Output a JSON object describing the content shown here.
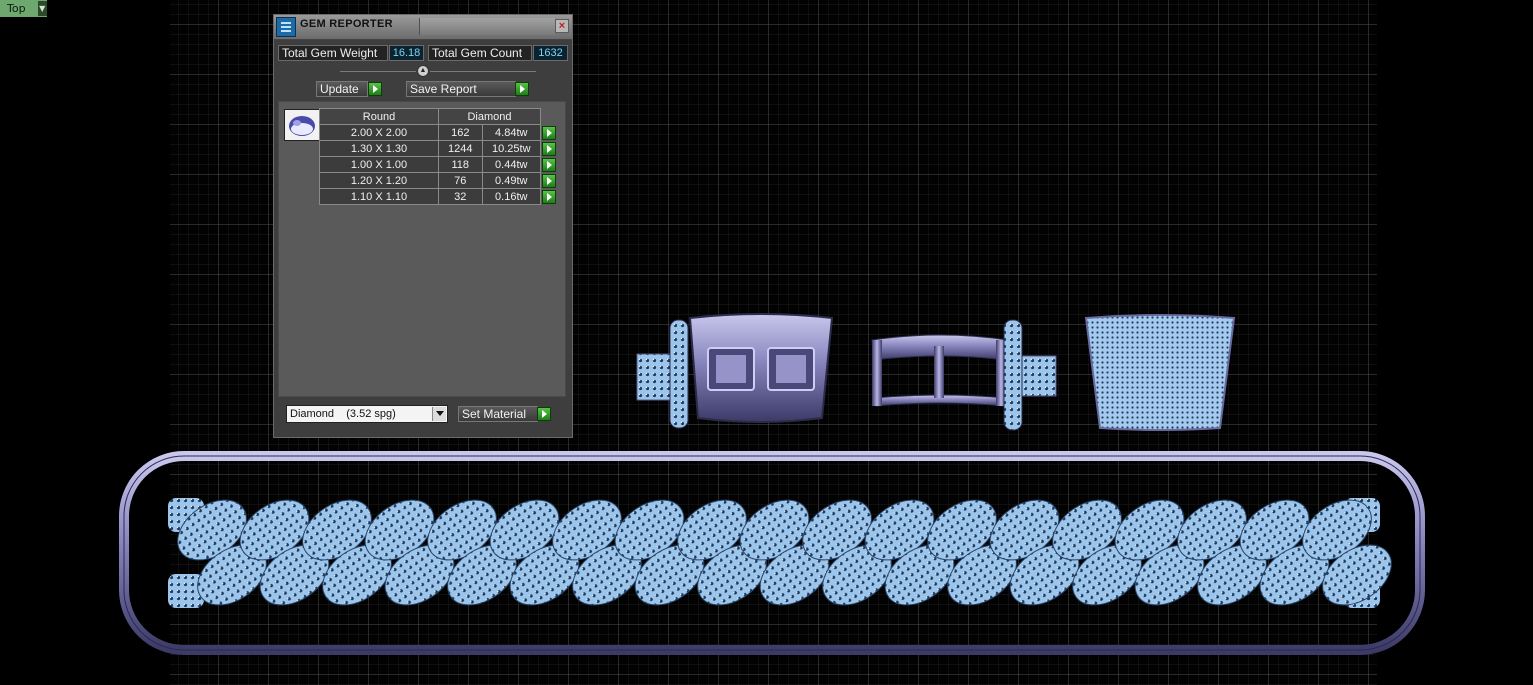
{
  "viewport": {
    "view_name": "Top",
    "view_dropdown_icon": "chevron-down-icon"
  },
  "panel": {
    "title": "GEM REPORTER",
    "app_icon": "gem-reporter-icon",
    "close_icon": "close-icon",
    "stats": {
      "weight_label": "Total Gem Weight",
      "weight_value": "16.18",
      "count_label": "Total Gem Count",
      "count_value": "1632"
    },
    "buttons": {
      "update": "Update",
      "save_report": "Save Report",
      "set_material": "Set Material"
    },
    "table": {
      "headers": [
        "Round",
        "Diamond"
      ],
      "rows": [
        {
          "size": "2.00 X 2.00",
          "count": "162",
          "weight": "4.84tw"
        },
        {
          "size": "1.30 X 1.30",
          "count": "1244",
          "weight": "10.25tw"
        },
        {
          "size": "1.00 X 1.00",
          "count": "118",
          "weight": "0.44tw"
        },
        {
          "size": "1.20 X 1.20",
          "count": "76",
          "weight": "0.49tw"
        },
        {
          "size": "1.10 X 1.10",
          "count": "32",
          "weight": "0.16tw"
        }
      ]
    },
    "material": {
      "selected": "Diamond    (3.52 spg)"
    }
  },
  "colors": {
    "metal": "#8a88c0",
    "metal_dark": "#4b4a78",
    "gem": "#9fc8ee",
    "gem_dark": "#1e3550",
    "grid": "#3a3a3a",
    "accent_green": "#3fa83a"
  }
}
